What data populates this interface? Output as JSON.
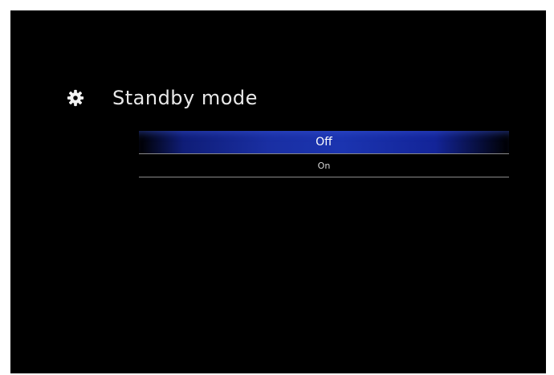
{
  "header": {
    "icon": "gear-icon",
    "title": "Standby mode"
  },
  "menu": {
    "options": [
      {
        "label": "Off",
        "selected": true
      },
      {
        "label": "On",
        "selected": false
      }
    ]
  },
  "colors": {
    "background": "#000000",
    "selection": "#1b34b0",
    "text": "#e6e6e6"
  }
}
